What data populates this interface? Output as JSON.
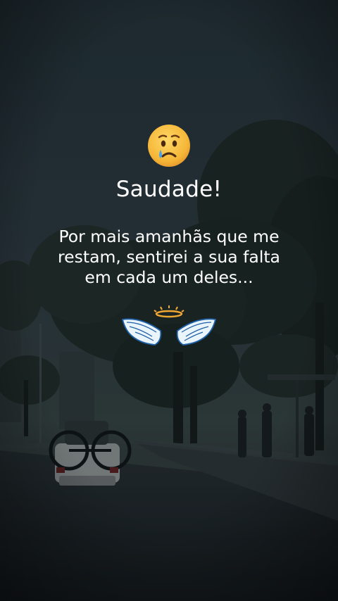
{
  "post": {
    "title": "Saudade!",
    "message_lines": [
      "Por mais amanhãs que me",
      "restam, sentirei a sua falta",
      "em cada um deles..."
    ],
    "emoji_top": "sad-tear-face-icon",
    "emoji_bottom": "angel-wings-halo-icon"
  },
  "colors": {
    "text": "#ffffff",
    "sky": "#2a363d",
    "foliage": "#1b2522",
    "road": "#1d2328",
    "emoji_face": "#f3b63b",
    "tear": "#4aa3e6",
    "halo": "#f0a832",
    "wing": "#e8f3fb",
    "wing_outline": "#1f5fa6"
  }
}
